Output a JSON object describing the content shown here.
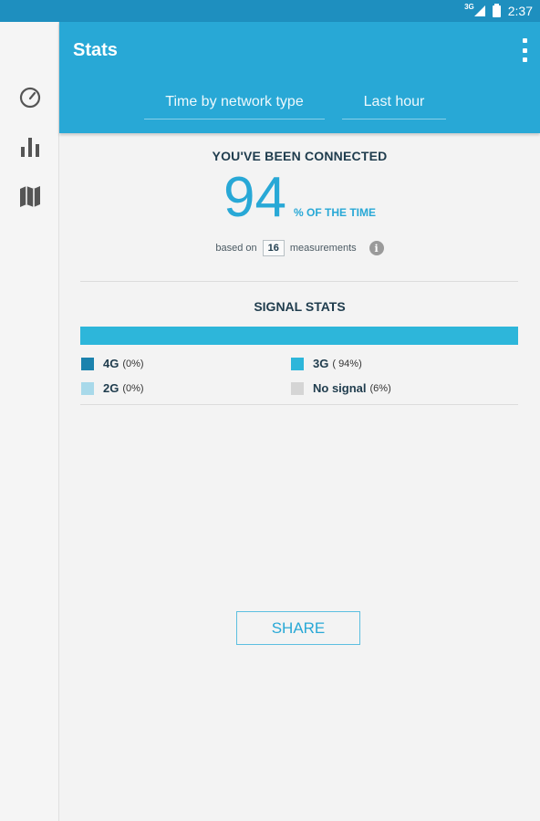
{
  "status_bar": {
    "network_type": "3G",
    "time": "2:37"
  },
  "side_rail": {
    "items": [
      {
        "name": "speedometer-icon"
      },
      {
        "name": "bar-chart-icon"
      },
      {
        "name": "map-icon"
      }
    ]
  },
  "app_bar": {
    "title": "Stats",
    "network_filter": "Time by network type",
    "time_filter": "Last hour"
  },
  "connection": {
    "heading": "YOU'VE BEEN CONNECTED",
    "percent": "94",
    "percent_suffix": "% OF THE TIME",
    "based_on_label": "based on",
    "measurements_count": "16",
    "measurements_label": "measurements"
  },
  "signal_stats": {
    "heading": "SIGNAL STATS",
    "bar_percentages": {
      "4G": 0,
      "3G": 94,
      "2G": 0,
      "No signal": 6
    },
    "legend": [
      {
        "label": "4G",
        "pct": "(0%)",
        "color": "#1b82ad"
      },
      {
        "label": "3G",
        "pct": "( 94%)",
        "color": "#2db6da"
      },
      {
        "label": "2G",
        "pct": "(0%)",
        "color": "#a8d9ea"
      },
      {
        "label": "No signal",
        "pct": "(6%)",
        "color": "#d5d5d5"
      }
    ]
  },
  "share_label": "SHARE",
  "colors": {
    "status_bar": "#1e8fbf",
    "app_bar": "#28a8d6",
    "accent": "#28a8d6",
    "text_dark": "#1f3c4d"
  }
}
